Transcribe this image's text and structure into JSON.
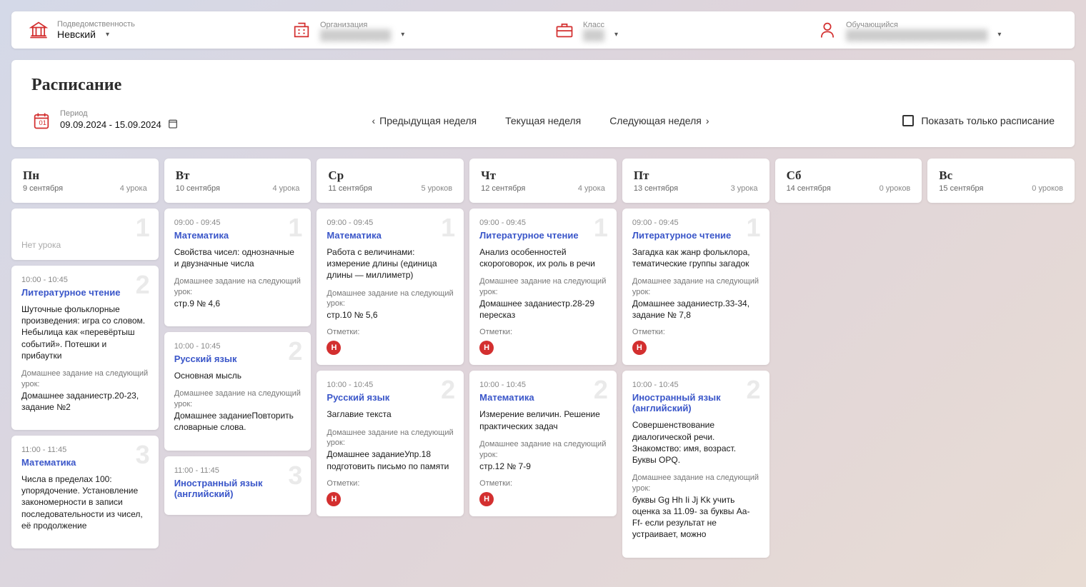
{
  "filters": {
    "jurisdiction": {
      "label": "Подведомственность",
      "value": "Невский"
    },
    "organization": {
      "label": "Организация",
      "value": "██████████"
    },
    "class": {
      "label": "Класс",
      "value": "███"
    },
    "student": {
      "label": "Обучающийся",
      "value": "████████████████████"
    }
  },
  "schedule": {
    "title": "Расписание",
    "period_label": "Период",
    "period_value": "09.09.2024 - 15.09.2024",
    "nav_prev": "Предыдущая неделя",
    "nav_cur": "Текущая неделя",
    "nav_next": "Следующая неделя",
    "show_only": "Показать только расписание"
  },
  "labels": {
    "no_lesson": "Нет урока",
    "hw_label": "Домашнее задание на следующий урок:",
    "marks_label": "Отметки:"
  },
  "days": [
    {
      "abbr": "Пн",
      "date": "9 сентября",
      "count": "4 урока"
    },
    {
      "abbr": "Вт",
      "date": "10 сентября",
      "count": "4 урока"
    },
    {
      "abbr": "Ср",
      "date": "11 сентября",
      "count": "5 уроков"
    },
    {
      "abbr": "Чт",
      "date": "12 сентября",
      "count": "4 урока"
    },
    {
      "abbr": "Пт",
      "date": "13 сентября",
      "count": "3 урока"
    },
    {
      "abbr": "Сб",
      "date": "14 сентября",
      "count": "0 уроков"
    },
    {
      "abbr": "Вс",
      "date": "15 сентября",
      "count": "0 уроков"
    }
  ],
  "lessons": {
    "mon": [
      {
        "num": "2",
        "time": "10:00 - 10:45",
        "subj": "Литературное чтение",
        "topic": "Шуточные фольклорные произведения: игра со словом. Небылица как «перевёртыш событий». Потешки и прибаутки",
        "hw": "Домашнее заданиестр.20-23, задание №2"
      },
      {
        "num": "3",
        "time": "11:00 - 11:45",
        "subj": "Математика",
        "topic": "Числа в пределах 100: упорядочение. Установление закономерности в записи последовательности из чисел, её продолжение",
        "hw": ""
      }
    ],
    "tue": [
      {
        "num": "1",
        "time": "09:00 - 09:45",
        "subj": "Математика",
        "topic": "Свойства чисел: однозначные и двузначные числа",
        "hw": "стр.9 № 4,6"
      },
      {
        "num": "2",
        "time": "10:00 - 10:45",
        "subj": "Русский язык",
        "topic": "Основная мысль",
        "hw": "Домашнее заданиеПовторить словарные слова."
      },
      {
        "num": "3",
        "time": "11:00 - 11:45",
        "subj": "Иностранный язык (английский)",
        "topic": "",
        "hw": ""
      }
    ],
    "wed": [
      {
        "num": "1",
        "time": "09:00 - 09:45",
        "subj": "Математика",
        "topic": "Работа с величинами: измерение длины (единица длины — миллиметр)",
        "hw": "стр.10 № 5,6",
        "mark": "Н"
      },
      {
        "num": "2",
        "time": "10:00 - 10:45",
        "subj": "Русский язык",
        "topic": "Заглавие текста",
        "hw": "Домашнее заданиеУпр.18 подготовить письмо по памяти",
        "mark": "Н"
      }
    ],
    "thu": [
      {
        "num": "1",
        "time": "09:00 - 09:45",
        "subj": "Литературное чтение",
        "topic": "Анализ особенностей скороговорок, их роль в речи",
        "hw": "Домашнее заданиестр.28-29 пересказ",
        "mark": "Н"
      },
      {
        "num": "2",
        "time": "10:00 - 10:45",
        "subj": "Математика",
        "topic": "Измерение величин.  Решение практических задач",
        "hw": "стр.12 № 7-9",
        "mark": "Н"
      }
    ],
    "fri": [
      {
        "num": "1",
        "time": "09:00 - 09:45",
        "subj": "Литературное чтение",
        "topic": "Загадка как жанр фольклора, тематические группы загадок",
        "hw": "Домашнее заданиестр.33-34, задание № 7,8",
        "mark": "Н"
      },
      {
        "num": "2",
        "time": "10:00 - 10:45",
        "subj": "Иностранный язык (английский)",
        "topic": "Совершенствование диалогической речи. Знакомство: имя, возраст. Буквы OPQ.",
        "hw": "буквы Gg Hh Ii Jj Kk учить оценка за 11.09- за буквы Aa-Ff- если результат не устраивает, можно"
      }
    ]
  }
}
